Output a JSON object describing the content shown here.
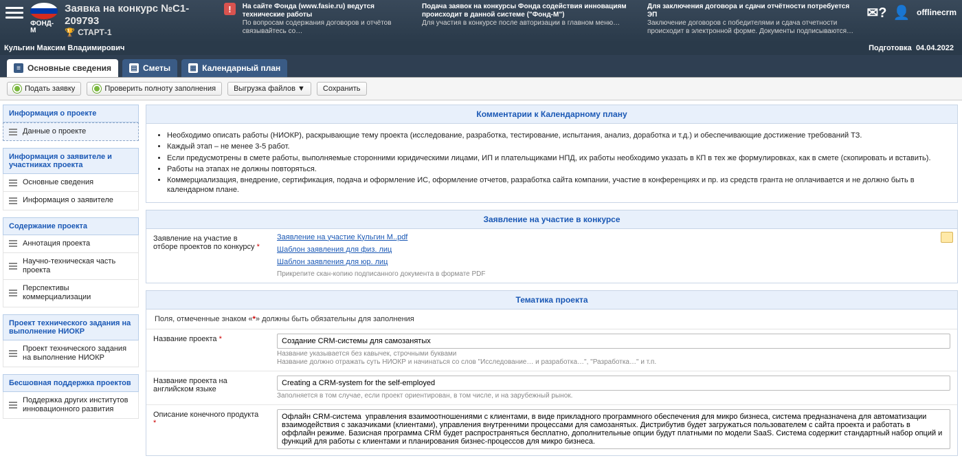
{
  "header": {
    "logo_text": "ФОНД-М",
    "app_title": "Заявка на конкурс №С1-209793",
    "subtitle_icon": "🏆",
    "subtitle": "СТАРТ-1",
    "warn": "!",
    "info1_b": "На сайте Фонда (www.fasie.ru) ведутся технические работы",
    "info1": "По вопросам содержания договоров и отчётов связывайтесь со…",
    "info2_b": "Подача заявок на конкурсы Фонда содействия инновациям происходит в данной системе (\"Фонд-М\")",
    "info2": "Для участия в конкурсе после авторизации в главном меню…",
    "info3_b": "Для заключения договора и сдачи отчётности потребуется ЭП",
    "info3": "Заключение договоров с победителями и сдача отчетности происходит в электронной форме. Документы подписываются…",
    "username": "offlinecrm"
  },
  "subheader": {
    "person": "Кульгин Максим Владимирович",
    "status": "Подготовка",
    "date": "04.04.2022"
  },
  "tabs": {
    "t1": "Основные сведения",
    "t2": "Сметы",
    "t3": "Календарный план"
  },
  "toolbar": {
    "submit": "Подать заявку",
    "check": "Проверить полноту заполнения",
    "export": "Выгрузка файлов ▼",
    "save": "Сохранить"
  },
  "sidebar": {
    "g1": "Информация о проекте",
    "g1_items": [
      "Данные о проекте"
    ],
    "g2": "Информация о заявителе и участниках проекта",
    "g2_items": [
      "Основные сведения",
      "Информация о заявителе"
    ],
    "g3": "Содержание проекта",
    "g3_items": [
      "Аннотация проекта",
      "Научно-техническая часть проекта",
      "Перспективы коммерциализации"
    ],
    "g4": "Проект технического задания на выполнение НИОКР",
    "g4_items": [
      "Проект технического задания на выполнение НИОКР"
    ],
    "g5": "Бесшовная поддержка проектов",
    "g5_items": [
      "Поддержка других институтов инновационного развития"
    ]
  },
  "panels": {
    "comments_title": "Комментарии к Календарному плану",
    "comments_items": [
      "Необходимо описать работы (НИОКР), раскрывающие тему проекта (исследование, разработка, тестирование, испытания, анализ, доработка и т.д.) и обеспечивающие достижение требований ТЗ.",
      "Каждый этап – не менее 3-5 работ.",
      "Если предусмотрены в смете работы, выполняемые сторонними юридическими лицами, ИП и плательщиками НПД, их работы необходимо указать в КП в тех же формулировках, как в смете (скопировать и вставить).",
      "Работы на этапах не должны повторяться.",
      "Коммерциализация, внедрение, сертификация, подача и оформление ИС, оформление отчетов, разработка сайта компании, участие в конференциях и пр. из средств гранта не оплачивается и не должно быть в календарном плане."
    ],
    "application_title": "Заявление на участие в конкурсе",
    "application_label": "Заявление на участие в отборе проектов по конкурсу",
    "application_link1": "Заявление на участие Кульгин М..pdf",
    "application_link2": "Шаблон заявления для физ. лиц",
    "application_link3": "Шаблон заявления для юр. лиц",
    "application_hint": "Прикрепите скан-копию подписанного документа в формате PDF",
    "topic_title": "Тематика проекта",
    "required_note_pre": "Поля, отмеченные знаком «",
    "required_note_post": "» должны быть обязательны для заполнения",
    "name_label": "Название проекта",
    "name_value": "Создание CRM-системы для самозанятых",
    "name_hint": "Название указывается без кавычек, строчными буквами\nНазвание должно отражать суть НИОКР и начинаться со слов \"Исследование… и разработка…\", \"Разработка…\" и т.п.",
    "name_en_label": "Название проекта на английском языке",
    "name_en_value": "Creating a CRM-system for the self-employed",
    "name_en_hint": "Заполняется в том случае, если проект ориентирован, в том числе, и на зарубежный рынок.",
    "desc_label": "Описание конечного продукта",
    "desc_value": "Офлайн CRM-система  управления взаимоотношениями с клиентами, в виде прикладного программного обеспечения для микро бизнеса, система предназначена для автоматизации взаимодействия с заказчиками (клиентами), управления внутренними процессами для самозанятых. Дистрибутив будет загружаться пользователем с сайта проекта и работать в оффлайн режиме. Базисная программа CRM будет распространяться бесплатно, дополнительные опции будут платными по модели SaaS. Система содержит стандартный набор опций и функций для работы с клиентами и планирования бизнес-процессов для микро бизнеса."
  }
}
